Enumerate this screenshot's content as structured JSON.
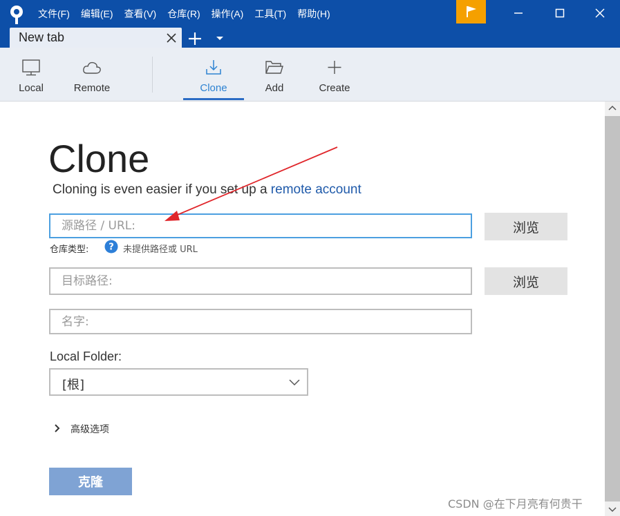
{
  "menu": [
    "文件(F)",
    "编辑(E)",
    "查看(V)",
    "仓库(R)",
    "操作(A)",
    "工具(T)",
    "帮助(H)"
  ],
  "tab": {
    "title": "New tab"
  },
  "toolbar": {
    "local": "Local",
    "remote": "Remote",
    "clone": "Clone",
    "add": "Add",
    "create": "Create"
  },
  "page": {
    "title": "Clone",
    "subtitle_prefix": "Cloning is even easier if you set up a ",
    "subtitle_link": "remote account"
  },
  "form": {
    "source_placeholder": "源路径 / URL:",
    "browse_label": "浏览",
    "repo_type_label": "仓库类型:",
    "repo_type_value": "未提供路径或 URL",
    "dest_placeholder": "目标路径:",
    "name_placeholder": "名字:",
    "local_folder_label": "Local Folder:",
    "local_folder_value": "[根]",
    "advanced_label": "高级选项",
    "clone_button": "克隆"
  },
  "watermark": "CSDN @在下月亮有何贵干",
  "colors": {
    "titlebar": "#0d4fa8",
    "flag": "#f5a000",
    "accent": "#2d82d2",
    "clone_button": "#7fa3d4",
    "annotation_arrow": "#e0262b"
  }
}
